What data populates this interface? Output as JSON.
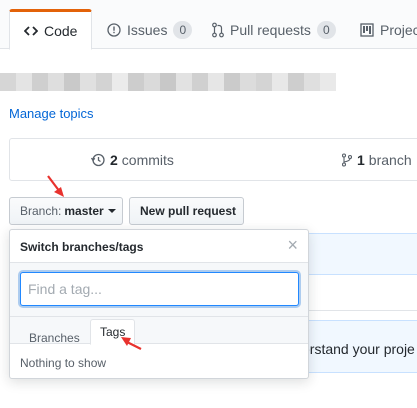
{
  "tabs": [
    {
      "label": "Code",
      "icon": "code-icon",
      "selected": true
    },
    {
      "label": "Issues",
      "icon": "issue-opened-icon",
      "count": "0"
    },
    {
      "label": "Pull requests",
      "icon": "git-pull-request-icon",
      "count": "0"
    },
    {
      "label": "Projec",
      "icon": "project-icon"
    }
  ],
  "description_blurred": true,
  "manage_topics": "Manage topics",
  "stats": {
    "commits_count": "2",
    "commits_label": "commits",
    "branches_count": "1",
    "branches_label": "branch"
  },
  "branch_button": {
    "prefix": "Branch:",
    "value": "master"
  },
  "new_pull_request": "New pull request",
  "dropdown": {
    "title": "Switch branches/tags",
    "close": "×",
    "filter_placeholder": "Find a tag...",
    "tabs": [
      "Branches",
      "Tags"
    ],
    "selected_tab": "Tags",
    "empty_text": "Nothing to show"
  },
  "background_banner_text": "erstand your proje",
  "colors": {
    "accent": "#e36209",
    "link": "#0366d6",
    "annotation_arrow": "#e8322e",
    "focus_ring": "#2188ff"
  }
}
